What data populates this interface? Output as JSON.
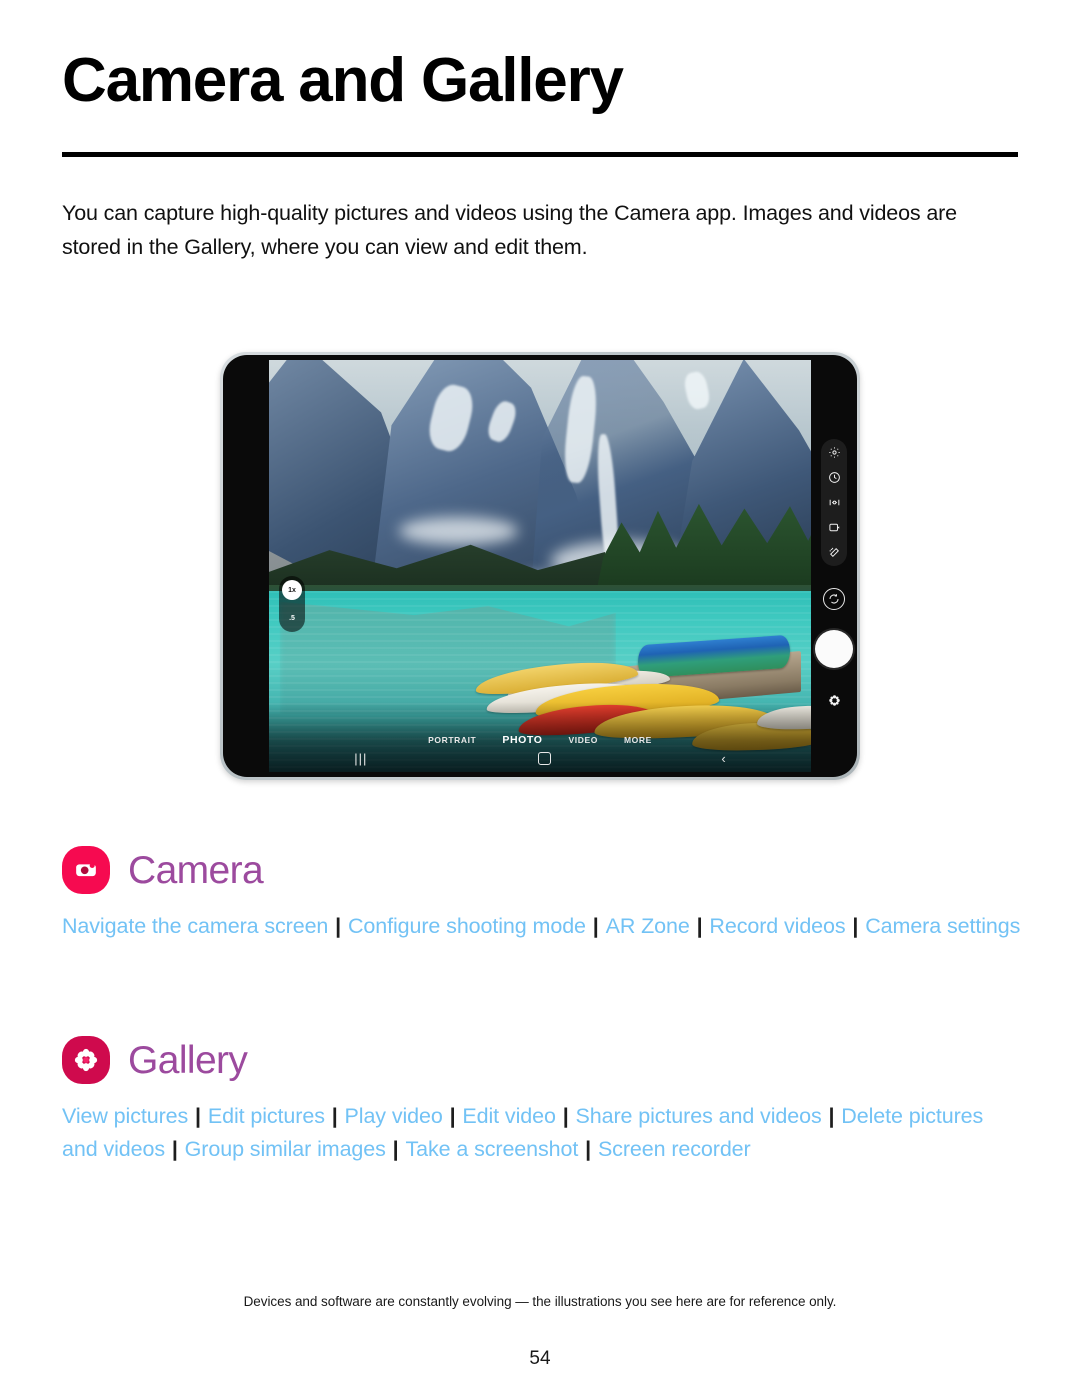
{
  "page": {
    "title": "Camera and Gallery",
    "intro": "You can capture high-quality pictures and videos using the Camera app. Images and videos are stored in the Gallery, where you can view and edit them.",
    "footnote": "Devices and software are constantly evolving — the illustrations you see here are for reference only.",
    "page_number": "54",
    "colors": {
      "link": "#72c2f5",
      "heading": "#9c4a9e",
      "camera_icon_bg": "#f60a50",
      "gallery_icon_bg": "#cf0a4d",
      "rule": "#000000",
      "separator": "#1d1d1d"
    }
  },
  "sections": [
    {
      "id": "camera",
      "icon_name": "camera-app-icon",
      "title": "Camera",
      "links": [
        "Navigate the camera screen",
        "Configure shooting mode",
        "AR Zone",
        "Record videos",
        "Camera settings"
      ],
      "separator": "|"
    },
    {
      "id": "gallery",
      "icon_name": "gallery-app-icon",
      "title": "Gallery",
      "links": [
        "View pictures",
        "Edit pictures",
        "Play video",
        "Edit video",
        "Share pictures and videos",
        "Delete pictures and videos",
        "Group similar images",
        "Take a screenshot",
        "Screen recorder"
      ],
      "separator": "|"
    }
  ],
  "illustration": {
    "device": "tablet-landscape",
    "scene_description": "Camera viewfinder showing a turquoise mountain lake with canoes on a dock",
    "zoom_controls": [
      {
        "label": "1x",
        "selected": true
      },
      {
        "label": ".5",
        "selected": false
      }
    ],
    "modes": [
      {
        "label": "PORTRAIT",
        "selected": false
      },
      {
        "label": "PHOTO",
        "selected": true
      },
      {
        "label": "VIDEO",
        "selected": false
      },
      {
        "label": "MORE",
        "selected": false
      }
    ],
    "side_controls": [
      "settings-icon",
      "timer-icon",
      "motion-photo-icon",
      "aspect-ratio-icon",
      "effects-icon"
    ],
    "flip_camera": "switch-camera-icon",
    "shutter": "shutter-button",
    "gallery_shortcut": "gallery-thumbnail-icon",
    "nav_bar": [
      "recents-icon",
      "home-icon",
      "back-icon"
    ]
  }
}
